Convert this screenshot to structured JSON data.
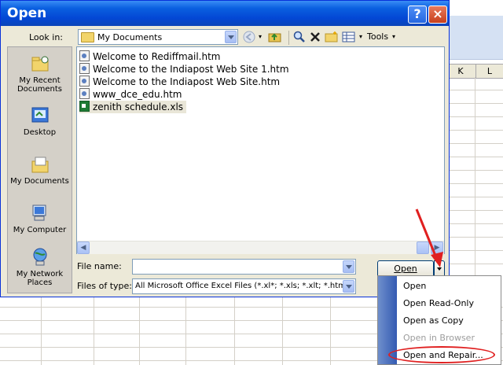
{
  "dialog": {
    "title": "Open",
    "help_label": "?",
    "close_label": "×"
  },
  "toolbar": {
    "look_in_label": "Look in:",
    "look_in_value": "My Documents",
    "tools_label": "Tools"
  },
  "places": [
    {
      "label": "My Recent Documents",
      "icon": "recent-documents-icon"
    },
    {
      "label": "Desktop",
      "icon": "desktop-icon"
    },
    {
      "label": "My Documents",
      "icon": "my-documents-icon"
    },
    {
      "label": "My Computer",
      "icon": "my-computer-icon"
    },
    {
      "label": "My Network Places",
      "icon": "network-places-icon"
    }
  ],
  "files": [
    {
      "name": "Welcome to Rediffmail.htm",
      "type": "htm"
    },
    {
      "name": "Welcome to the Indiapost Web Site 1.htm",
      "type": "htm"
    },
    {
      "name": "Welcome to the Indiapost Web Site.htm",
      "type": "htm"
    },
    {
      "name": "www_dce_edu.htm",
      "type": "htm"
    },
    {
      "name": "zenith schedule.xls",
      "type": "xls"
    }
  ],
  "file_name": {
    "label": "File name:",
    "value": ""
  },
  "files_of_type": {
    "label": "Files of type:",
    "value": "All Microsoft Office Excel Files (*.xl*; *.xls; *.xlt; *.htm;"
  },
  "open_button": {
    "label": "Open"
  },
  "open_menu": {
    "items": [
      {
        "label": "Open",
        "enabled": true
      },
      {
        "label": "Open Read-Only",
        "enabled": true
      },
      {
        "label": "Open as Copy",
        "enabled": true
      },
      {
        "label": "Open in Browser",
        "enabled": false
      },
      {
        "label": "Open and Repair...",
        "enabled": true
      }
    ]
  },
  "spreadsheet": {
    "column_headers": [
      "K",
      "L"
    ]
  },
  "colors": {
    "titlebar": "#0347d4",
    "annotation": "#e02020"
  }
}
